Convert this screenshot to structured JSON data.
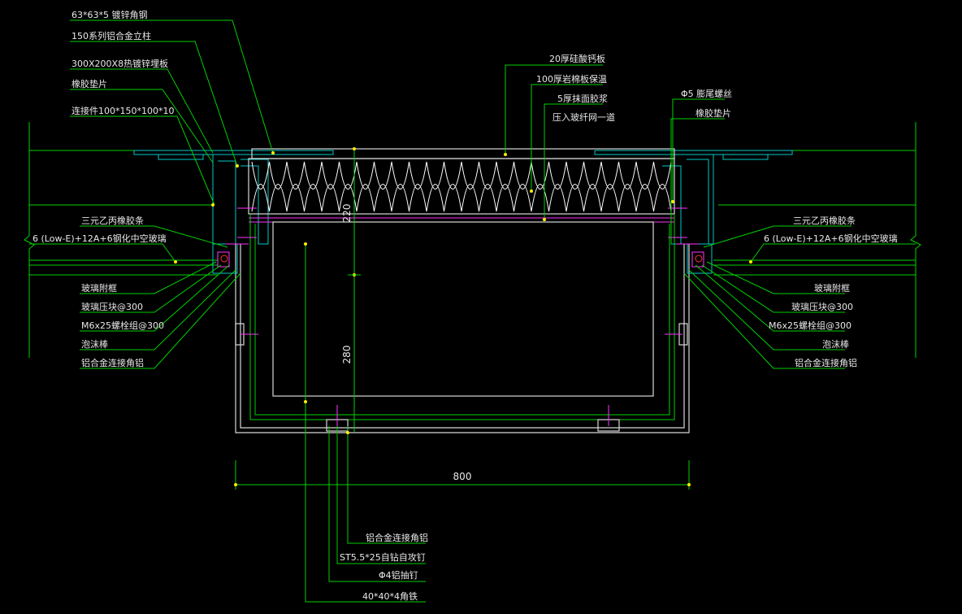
{
  "labels_left": [
    "63*63*5 镀锌角钢",
    "150系列铝合金立柱",
    "300X200X8热镀锌埋板",
    "橡胶垫片",
    "连接件100*150*100*10",
    "三元乙丙橡胶条",
    "6 (Low-E)+12A+6钢化中空玻璃",
    "玻璃附框",
    "玻璃压块@300",
    "M6x25螺栓组@300",
    "泡沫棒",
    "铝合金连接角铝"
  ],
  "labels_right": [
    "Φ5 膨尾螺丝",
    "橡胶垫片",
    "三元乙丙橡胶条",
    "6 (Low-E)+12A+6钢化中空玻璃",
    "玻璃附框",
    "玻璃压块@300",
    "M6x25螺栓组@300",
    "泡沫棒",
    "铝合金连接角铝"
  ],
  "labels_top": [
    "20厚硅酸钙板",
    "100厚岩棉板保温",
    "5厚抹面胶浆",
    "压入玻纤网一道"
  ],
  "labels_bottom": [
    "铝合金连接角铝",
    "ST5.5*25自钻自攻钉",
    "Φ4铝抽钉",
    "40*40*4角铁"
  ],
  "dimensions": {
    "width": "800",
    "upper_height": "220",
    "lower_height": "280"
  },
  "colors": {
    "background": "#000000",
    "leader": "#00d000",
    "outline": "#d8d8d8",
    "profile": "#00c8c8",
    "detail": "#ff33ff",
    "marker": "#ffee00"
  }
}
